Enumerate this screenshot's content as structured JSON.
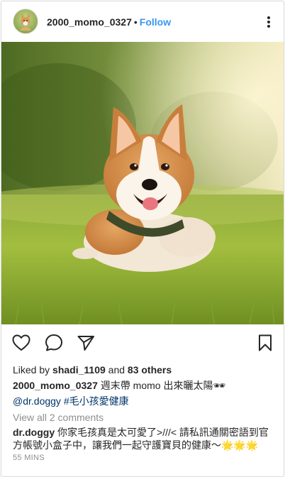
{
  "header": {
    "username": "2000_momo_0327",
    "separator": "•",
    "follow_label": "Follow"
  },
  "icons": {
    "like": "heart-icon",
    "comment": "speech-bubble-icon",
    "share": "paper-plane-icon",
    "save": "bookmark-icon",
    "more": "vertical-ellipsis-icon"
  },
  "likes": {
    "prefix": "Liked by",
    "user": "shadi_1109",
    "conjunction": "and",
    "others": "83 others"
  },
  "caption": {
    "username": "2000_momo_0327",
    "text": "週末帶 momo 出來曬太陽🕶",
    "mentions": [
      "@dr.doggy",
      "#毛小孩愛健康"
    ]
  },
  "comments": {
    "view_all": "View all 2 comments",
    "items": [
      {
        "username": "dr.doggy",
        "text": "你家毛孩真是太可愛了>///< 請私訊通關密語到官方帳號小盒子中，讓我們一起守護寶貝的健康～🌟🌟🌟"
      }
    ]
  },
  "timestamp": "55 MINS",
  "colors": {
    "link_blue": "#3897f0",
    "hashtag": "#003569",
    "muted": "#8e8e8e",
    "text": "#262626",
    "border": "#dbdbdb"
  }
}
